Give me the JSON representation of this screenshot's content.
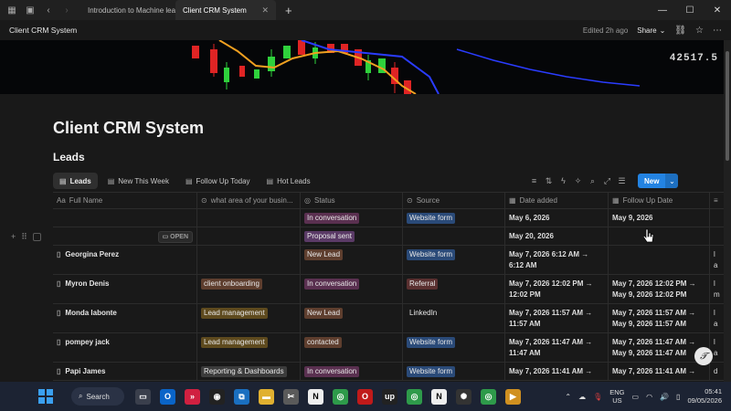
{
  "browser": {
    "tabs": [
      {
        "label": "Introduction to Machine lea",
        "active": false
      },
      {
        "label": "Client CRM System",
        "active": true
      }
    ]
  },
  "header": {
    "breadcrumb": "Client CRM System",
    "edited": "Edited 2h ago",
    "share_label": "Share"
  },
  "cover": {
    "price_text": "42517.5"
  },
  "page": {
    "title": "Client CRM System",
    "database_title": "Leads"
  },
  "views": [
    {
      "label": "Leads",
      "icon": "table-icon",
      "active": true
    },
    {
      "label": "New This Week",
      "icon": "table-icon",
      "active": false
    },
    {
      "label": "Follow Up Today",
      "icon": "table-icon",
      "active": false
    },
    {
      "label": "Hot Leads",
      "icon": "table-icon",
      "active": false
    }
  ],
  "toolbar": {
    "new_label": "New"
  },
  "columns": [
    {
      "label": "Full Name",
      "icon": "text-icon"
    },
    {
      "label": "what area of your busin...",
      "icon": "select-icon"
    },
    {
      "label": "Status",
      "icon": "status-icon"
    },
    {
      "label": "Source",
      "icon": "select-icon"
    },
    {
      "label": "Date added",
      "icon": "calendar-icon"
    },
    {
      "label": "Follow Up Date",
      "icon": "calendar-icon"
    }
  ],
  "rows": [
    {
      "name": "",
      "area": "",
      "area_color": "",
      "status": "In conversation",
      "status_color": "#5a3050",
      "source": "Website form",
      "source_color": "#2a4a78",
      "date_added": "May 6, 2026",
      "follow_up": "May 9, 2026"
    },
    {
      "name": "",
      "area": "",
      "area_color": "",
      "status": "Proposal sent",
      "status_color": "#5a3a66",
      "source": "",
      "source_color": "",
      "date_added": "May 20, 2026",
      "follow_up": "",
      "open_label": "OPEN"
    },
    {
      "name": "Georgina Perez",
      "area": "",
      "area_color": "",
      "status": "New Lead",
      "status_color": "#5e3e2e",
      "source": "Website form",
      "source_color": "#2a4a78",
      "date_added": "May 7, 2026 6:12 AM → 6:12 AM",
      "follow_up": "",
      "extra": "l a"
    },
    {
      "name": "Myron Denis",
      "area": "client onboarding",
      "area_color": "#5e3e2e",
      "status": "In conversation",
      "status_color": "#5a3050",
      "source": "Referral",
      "source_color": "#5a3030",
      "date_added": "May 7, 2026 12:02 PM → 12:02 PM",
      "follow_up": "May 7, 2026 12:02 PM → May 9, 2026 12:02 PM",
      "extra": "l m"
    },
    {
      "name": "Monda labonte",
      "area": "Lead management",
      "area_color": "#5e4a1e",
      "status": "New Lead",
      "status_color": "#5e3e2e",
      "source": "LinkedIn",
      "source_color": "",
      "date_added": "May 7, 2026 11:57 AM → 11:57 AM",
      "follow_up": "May 7, 2026 11:57 AM → May 9, 2026 11:57 AM",
      "extra": "l a"
    },
    {
      "name": "pompey jack",
      "area": "Lead management",
      "area_color": "#5e4a1e",
      "status": "contacted",
      "status_color": "#5e3e2e",
      "source": "Website form",
      "source_color": "#2a4a78",
      "date_added": "May 7, 2026 11:47 AM → 11:47 AM",
      "follow_up": "May 7, 2026 11:47 AM → May 9, 2026 11:47 AM",
      "extra": "l a"
    },
    {
      "name": "Papi James",
      "area": "Reporting & Dashboards",
      "area_color": "#3c3c3c",
      "status": "In conversation",
      "status_color": "#5a3050",
      "source": "Website form",
      "source_color": "#2a4a78",
      "date_added": "May 7, 2026 11:41 AM →",
      "follow_up": "May 7, 2026 11:41 AM →",
      "extra": "d"
    }
  ],
  "taskbar": {
    "search_label": "Search",
    "lang_top": "ENG",
    "lang_bottom": "US",
    "time": "05:41",
    "date": "09/05/2026"
  }
}
